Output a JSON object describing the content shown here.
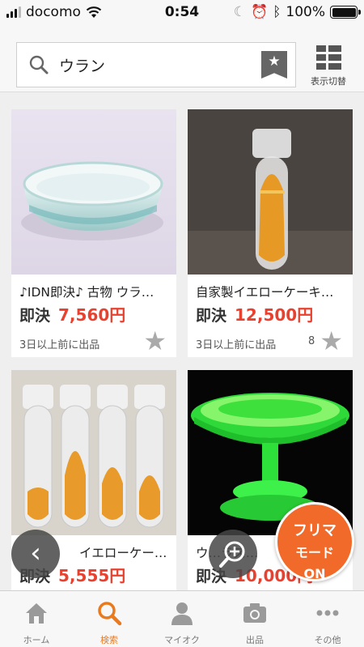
{
  "status_bar": {
    "carrier": "docomo",
    "time": "0:54",
    "battery": "100%"
  },
  "search": {
    "query": "ウラン",
    "view_toggle_label": "表示切替"
  },
  "items": [
    {
      "title": "♪IDN即決♪ 古物 ウラ…",
      "price_tag": "即決",
      "price": "7,560円",
      "posted": "3日以上前に出品",
      "watch_count": ""
    },
    {
      "title": "自家製イエローケーキ…",
      "price_tag": "即決",
      "price": "12,500円",
      "posted": "3日以上前に出品",
      "watch_count": "8"
    },
    {
      "title": "イエローケーキ…",
      "price_tag": "即決",
      "price": "5,555円",
      "posted": "",
      "watch_count": ""
    },
    {
      "title": "ウ…ラス…",
      "price_tag": "即決",
      "price": "10,000円",
      "posted": "",
      "watch_count": ""
    }
  ],
  "fleamarket_button": {
    "line1": "フリマ",
    "line2": "モード",
    "line3": "ON"
  },
  "tabs": [
    {
      "label": "ホーム",
      "icon": "home-icon"
    },
    {
      "label": "検索",
      "icon": "search-icon",
      "active": true
    },
    {
      "label": "マイオク",
      "icon": "person-icon"
    },
    {
      "label": "出品",
      "icon": "camera-icon"
    },
    {
      "label": "その他",
      "icon": "more-icon"
    }
  ],
  "colors": {
    "accent": "#f26a2a",
    "price": "#e8412f",
    "active_tab": "#ea7a1e"
  }
}
